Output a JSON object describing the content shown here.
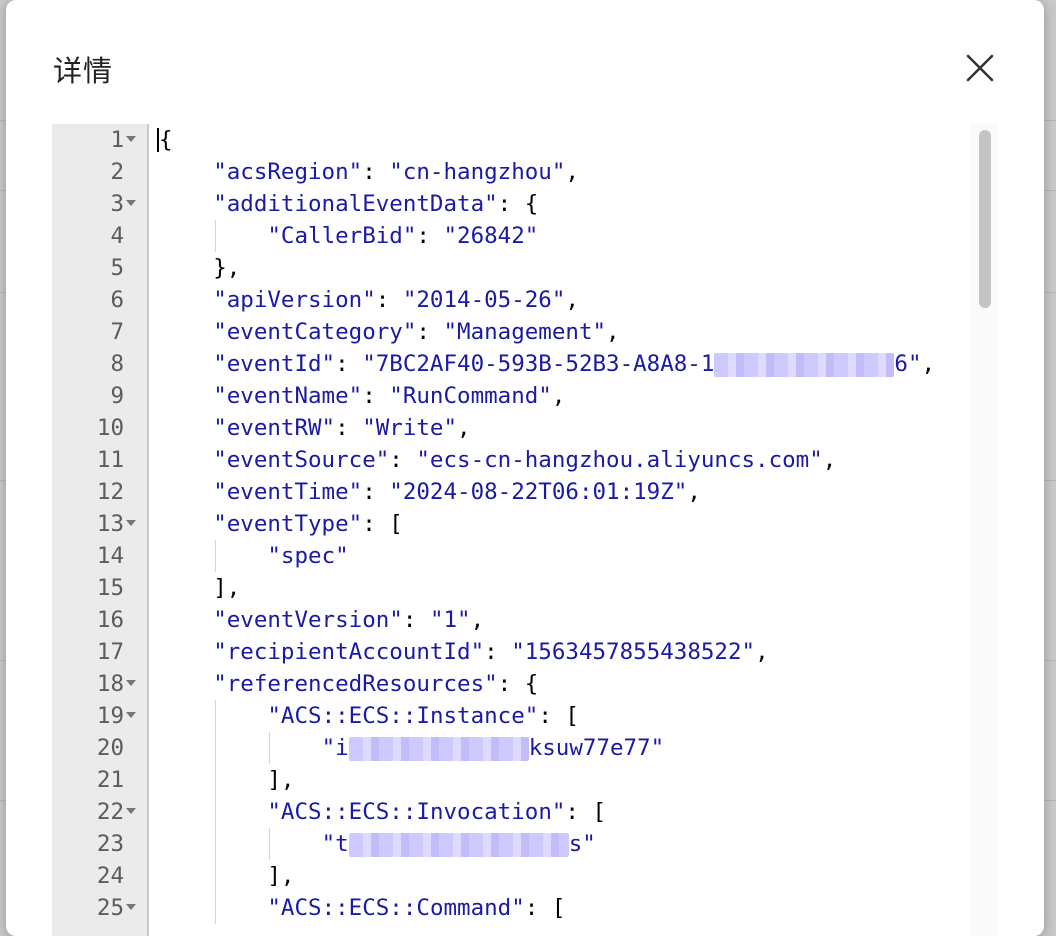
{
  "modal": {
    "title": "详情"
  },
  "icons": {
    "close": "close-icon",
    "fold": "fold-arrow-icon"
  },
  "editor": {
    "lines": [
      {
        "n": "1",
        "fold": true,
        "indent": 0,
        "parts": [
          [
            "p",
            "{"
          ]
        ]
      },
      {
        "n": "2",
        "fold": false,
        "indent": 1,
        "parts": [
          [
            "k",
            "\"acsRegion\""
          ],
          [
            "p",
            ": "
          ],
          [
            "s",
            "\"cn-hangzhou\""
          ],
          [
            "p",
            ","
          ]
        ]
      },
      {
        "n": "3",
        "fold": true,
        "indent": 1,
        "parts": [
          [
            "k",
            "\"additionalEventData\""
          ],
          [
            "p",
            ": {"
          ]
        ]
      },
      {
        "n": "4",
        "fold": false,
        "indent": 2,
        "parts": [
          [
            "k",
            "\"CallerBid\""
          ],
          [
            "p",
            ": "
          ],
          [
            "s",
            "\"26842\""
          ]
        ]
      },
      {
        "n": "5",
        "fold": false,
        "indent": 1,
        "parts": [
          [
            "p",
            "},"
          ]
        ]
      },
      {
        "n": "6",
        "fold": false,
        "indent": 1,
        "parts": [
          [
            "k",
            "\"apiVersion\""
          ],
          [
            "p",
            ": "
          ],
          [
            "s",
            "\"2014-05-26\""
          ],
          [
            "p",
            ","
          ]
        ]
      },
      {
        "n": "7",
        "fold": false,
        "indent": 1,
        "parts": [
          [
            "k",
            "\"eventCategory\""
          ],
          [
            "p",
            ": "
          ],
          [
            "s",
            "\"Management\""
          ],
          [
            "p",
            ","
          ]
        ]
      },
      {
        "n": "8",
        "fold": false,
        "indent": 1,
        "parts": [
          [
            "k",
            "\"eventId\""
          ],
          [
            "p",
            ": "
          ],
          [
            "s",
            "\"7BC2AF40-593B-52B3-A8A8-1"
          ],
          [
            "r",
            "180"
          ],
          [
            "s",
            "6\""
          ],
          [
            "p",
            ","
          ]
        ]
      },
      {
        "n": "9",
        "fold": false,
        "indent": 1,
        "parts": [
          [
            "k",
            "\"eventName\""
          ],
          [
            "p",
            ": "
          ],
          [
            "s",
            "\"RunCommand\""
          ],
          [
            "p",
            ","
          ]
        ]
      },
      {
        "n": "10",
        "fold": false,
        "indent": 1,
        "parts": [
          [
            "k",
            "\"eventRW\""
          ],
          [
            "p",
            ": "
          ],
          [
            "s",
            "\"Write\""
          ],
          [
            "p",
            ","
          ]
        ]
      },
      {
        "n": "11",
        "fold": false,
        "indent": 1,
        "parts": [
          [
            "k",
            "\"eventSource\""
          ],
          [
            "p",
            ": "
          ],
          [
            "s",
            "\"ecs-cn-hangzhou.aliyuncs.com\""
          ],
          [
            "p",
            ","
          ]
        ]
      },
      {
        "n": "12",
        "fold": false,
        "indent": 1,
        "parts": [
          [
            "k",
            "\"eventTime\""
          ],
          [
            "p",
            ": "
          ],
          [
            "s",
            "\"2024-08-22T06:01:19Z\""
          ],
          [
            "p",
            ","
          ]
        ]
      },
      {
        "n": "13",
        "fold": true,
        "indent": 1,
        "parts": [
          [
            "k",
            "\"eventType\""
          ],
          [
            "p",
            ": ["
          ]
        ]
      },
      {
        "n": "14",
        "fold": false,
        "indent": 2,
        "parts": [
          [
            "s",
            "\"spec\""
          ]
        ]
      },
      {
        "n": "15",
        "fold": false,
        "indent": 1,
        "parts": [
          [
            "p",
            "],"
          ]
        ]
      },
      {
        "n": "16",
        "fold": false,
        "indent": 1,
        "parts": [
          [
            "k",
            "\"eventVersion\""
          ],
          [
            "p",
            ": "
          ],
          [
            "s",
            "\"1\""
          ],
          [
            "p",
            ","
          ]
        ]
      },
      {
        "n": "17",
        "fold": false,
        "indent": 1,
        "parts": [
          [
            "k",
            "\"recipientAccountId\""
          ],
          [
            "p",
            ": "
          ],
          [
            "s",
            "\"1563457855438522\""
          ],
          [
            "p",
            ","
          ]
        ]
      },
      {
        "n": "18",
        "fold": true,
        "indent": 1,
        "parts": [
          [
            "k",
            "\"referencedResources\""
          ],
          [
            "p",
            ": {"
          ]
        ]
      },
      {
        "n": "19",
        "fold": true,
        "indent": 2,
        "parts": [
          [
            "k",
            "\"ACS::ECS::Instance\""
          ],
          [
            "p",
            ": ["
          ]
        ]
      },
      {
        "n": "20",
        "fold": false,
        "indent": 3,
        "parts": [
          [
            "s",
            "\"i"
          ],
          [
            "r",
            "180"
          ],
          [
            "s",
            "ksuw77e77\""
          ]
        ]
      },
      {
        "n": "21",
        "fold": false,
        "indent": 2,
        "parts": [
          [
            "p",
            "],"
          ]
        ]
      },
      {
        "n": "22",
        "fold": true,
        "indent": 2,
        "parts": [
          [
            "k",
            "\"ACS::ECS::Invocation\""
          ],
          [
            "p",
            ": ["
          ]
        ]
      },
      {
        "n": "23",
        "fold": false,
        "indent": 3,
        "parts": [
          [
            "s",
            "\"t"
          ],
          [
            "r",
            "220"
          ],
          [
            "s",
            "s\""
          ]
        ]
      },
      {
        "n": "24",
        "fold": false,
        "indent": 2,
        "parts": [
          [
            "p",
            "],"
          ]
        ]
      },
      {
        "n": "25",
        "fold": true,
        "indent": 2,
        "parts": [
          [
            "k",
            "\"ACS::ECS::Command\""
          ],
          [
            "p",
            ": ["
          ]
        ]
      }
    ]
  }
}
